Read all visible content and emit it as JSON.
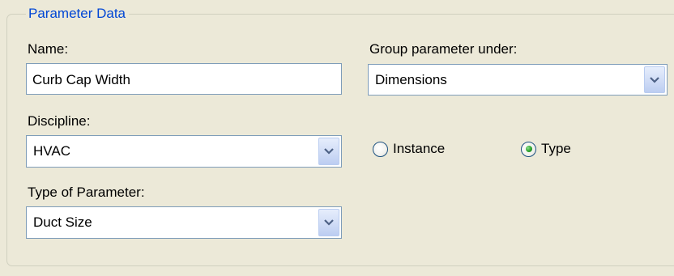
{
  "group": {
    "title": "Parameter Data"
  },
  "name": {
    "label": "Name:",
    "value": "Curb Cap Width"
  },
  "group_under": {
    "label": "Group parameter under:",
    "value": "Dimensions"
  },
  "discipline": {
    "label": "Discipline:",
    "value": "HVAC"
  },
  "type_of_parameter": {
    "label": "Type of Parameter:",
    "value": "Duct Size"
  },
  "scope": {
    "instance_label": "Instance",
    "type_label": "Type",
    "selected": "Type"
  },
  "colors": {
    "background": "#ece9d8",
    "legend_text": "#0046d5",
    "input_border": "#7f9db9",
    "radio_dot": "#2aa12a"
  },
  "icons": {
    "dropdown": "chevron-down-icon"
  }
}
